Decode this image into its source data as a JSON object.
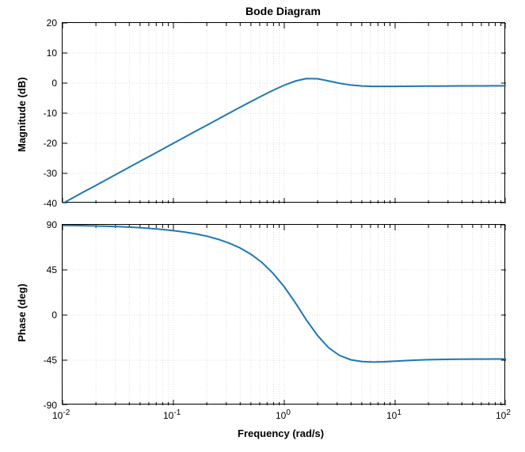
{
  "figure": {
    "title": "Bode Diagram",
    "xlabel": "Frequency  (rad/s)"
  },
  "chart_data": [
    {
      "type": "line",
      "name": "Magnitude",
      "ylabel": "Magnitude (dB)",
      "xscale": "log",
      "xlim": [
        0.01,
        100
      ],
      "ylim": [
        -40,
        20
      ],
      "yticks": [
        -40,
        -30,
        -20,
        -10,
        0,
        10,
        20
      ],
      "xticks": [
        0.01,
        0.1,
        1,
        10,
        100
      ],
      "xtick_labels": [
        "10^{-2}",
        "10^{-1}",
        "10^{0}",
        "10^{1}",
        "10^{2}"
      ],
      "x": [
        0.01,
        0.0126,
        0.0158,
        0.02,
        0.0251,
        0.0316,
        0.0398,
        0.0501,
        0.0631,
        0.0794,
        0.1,
        0.126,
        0.158,
        0.2,
        0.251,
        0.316,
        0.398,
        0.501,
        0.631,
        0.794,
        1,
        1.26,
        1.58,
        2,
        2.51,
        3.16,
        3.98,
        5.01,
        6.31,
        7.94,
        10,
        12.6,
        15.8,
        20,
        25.1,
        31.6,
        39.8,
        50.1,
        63.1,
        79.4,
        100
      ],
      "y": [
        -40,
        -38,
        -36,
        -34,
        -32,
        -30,
        -28,
        -26,
        -24,
        -22,
        -20,
        -18,
        -16.01,
        -14.02,
        -12.03,
        -10.04,
        -8.07,
        -6.12,
        -4.21,
        -2.37,
        -0.69,
        0.69,
        1.52,
        1.45,
        0.72,
        -0.07,
        -0.64,
        -0.95,
        -1.07,
        -1.1,
        -1.09,
        -1.06,
        -1.03,
        -1.0,
        -0.97,
        -0.95,
        -0.93,
        -0.92,
        -0.91,
        -0.9,
        -0.89
      ]
    },
    {
      "type": "line",
      "name": "Phase",
      "ylabel": "Phase (deg)",
      "xscale": "log",
      "xlim": [
        0.01,
        100
      ],
      "ylim": [
        -90,
        90
      ],
      "yticks": [
        -90,
        -45,
        0,
        45,
        90
      ],
      "xticks": [
        0.01,
        0.1,
        1,
        10,
        100
      ],
      "xtick_labels": [
        "10^{-2}",
        "10^{-1}",
        "10^{0}",
        "10^{1}",
        "10^{2}"
      ],
      "x": [
        0.01,
        0.0126,
        0.0158,
        0.02,
        0.0251,
        0.0316,
        0.0398,
        0.0501,
        0.0631,
        0.0794,
        0.1,
        0.126,
        0.158,
        0.2,
        0.251,
        0.316,
        0.398,
        0.501,
        0.631,
        0.794,
        1,
        1.26,
        1.58,
        2,
        2.51,
        3.16,
        3.98,
        5.01,
        6.31,
        7.94,
        10,
        12.6,
        15.8,
        20,
        25.1,
        31.6,
        39.8,
        50.1,
        63.1,
        79.4,
        100
      ],
      "y": [
        89.4,
        89.3,
        89.1,
        88.8,
        88.5,
        88.2,
        87.7,
        87.1,
        86.3,
        85.4,
        84.2,
        82.8,
        81.0,
        78.7,
        75.7,
        71.9,
        67.0,
        60.6,
        52.3,
        41.5,
        28.1,
        12.2,
        -4.8,
        -20.5,
        -32.6,
        -40.4,
        -44.6,
        -46.4,
        -46.9,
        -46.6,
        -46.0,
        -45.4,
        -44.9,
        -44.5,
        -44.3,
        -44.1,
        -44.0,
        -43.9,
        -43.9,
        -43.8,
        -43.8
      ]
    }
  ],
  "labels": {
    "yticks_mag": {
      "m40": "-40",
      "m30": "-30",
      "m20": "-20",
      "m10": "-10",
      "p0": "0",
      "p10": "10",
      "p20": "20"
    },
    "yticks_ph": {
      "m90": "-90",
      "m45": "-45",
      "p0": "0",
      "p45": "45",
      "p90": "90"
    },
    "xticks": {
      "d0": "-2",
      "d1": "-1",
      "d2": "0",
      "d3": "1",
      "d4": "2",
      "base": "10"
    }
  }
}
